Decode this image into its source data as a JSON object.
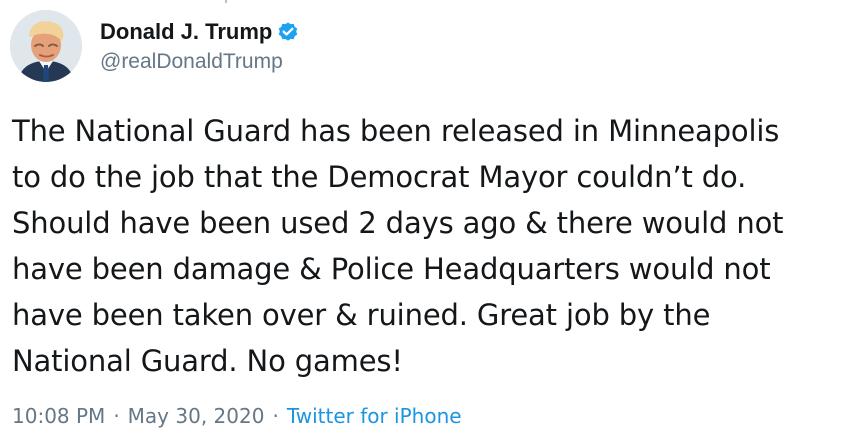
{
  "author": {
    "display_name": "Donald J. Trump",
    "handle": "@realDonaldTrump",
    "verified": true,
    "avatar_icon": "profile-photo-avatar",
    "verified_icon": "verified-badge-icon"
  },
  "tweet": {
    "lines": [
      "The National Guard has been released in Minneapolis",
      "to do the job that the Democrat Mayor couldn’t do.",
      "Should have been used 2 days ago & there would not",
      "have been damage & Police Headquarters would not",
      "have been taken over & ruined. Great job by the",
      "National Guard. No games!"
    ]
  },
  "meta": {
    "time": "10:08 PM",
    "separator": "·",
    "date": "May 30, 2020",
    "source": "Twitter for iPhone"
  },
  "colors": {
    "text": "#14171a",
    "secondary_text": "#657786",
    "link": "#1b95e0",
    "verified_badge": "#1da1f2",
    "background": "#ffffff"
  }
}
